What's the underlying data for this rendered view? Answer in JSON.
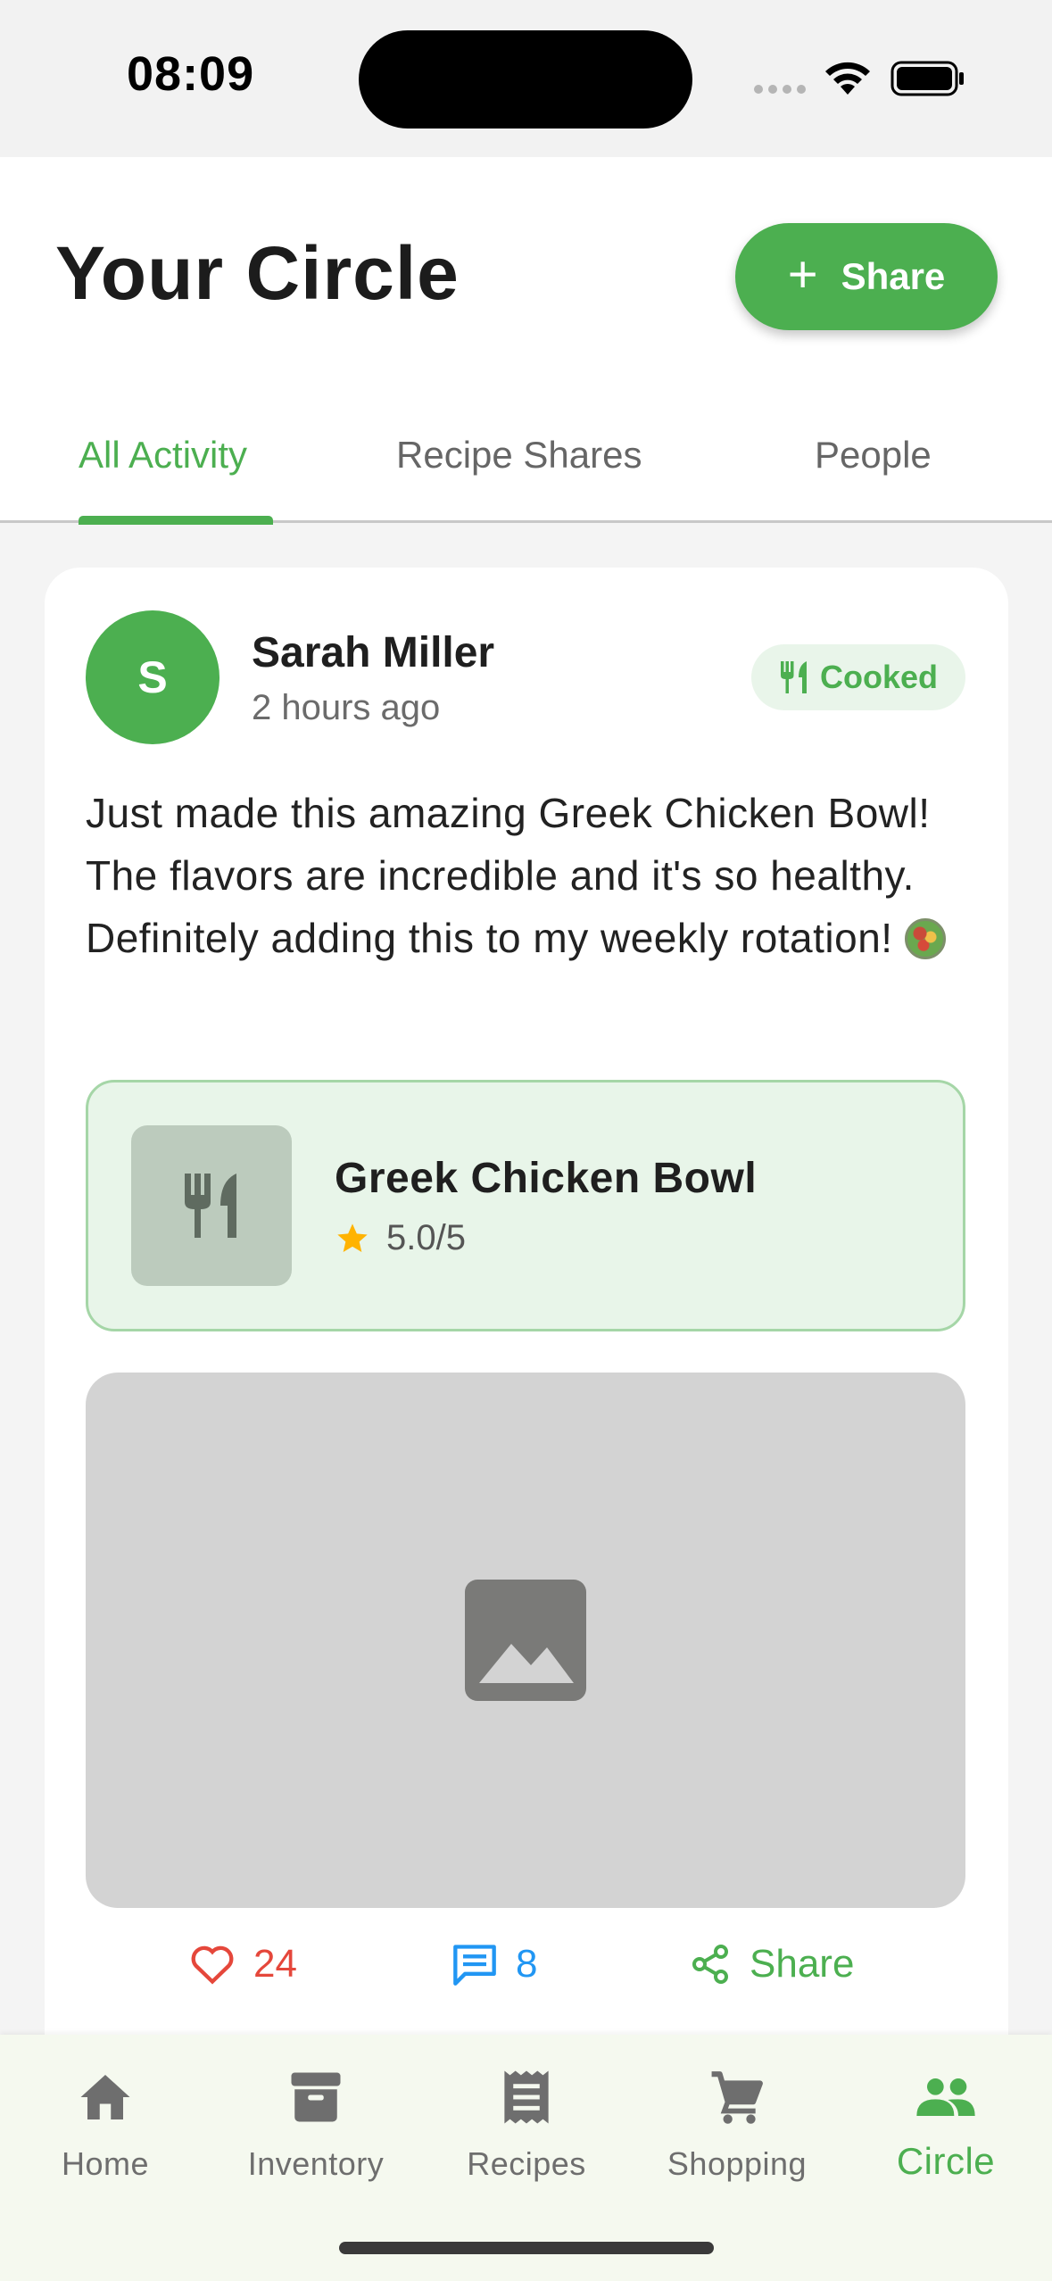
{
  "status_bar": {
    "time": "08:09"
  },
  "header": {
    "title": "Your Circle",
    "share_button_label": "Share"
  },
  "tabs": [
    {
      "label": "All Activity",
      "active": true
    },
    {
      "label": "Recipe Shares",
      "active": false
    },
    {
      "label": "People",
      "active": false
    }
  ],
  "post": {
    "author_initial": "S",
    "author_name": "Sarah Miller",
    "time_ago": "2 hours ago",
    "badge_label": "Cooked",
    "text": "Just made this amazing Greek Chicken Bowl! The flavors are incredible and it's so healthy. Definitely adding this to my weekly rotation!",
    "emoji_icon": "green-salad-emoji",
    "recipe": {
      "title": "Greek Chicken Bowl",
      "rating": "5.0/5"
    },
    "likes": "24",
    "comments": "8",
    "share_label": "Share"
  },
  "bottom_nav": {
    "items": [
      {
        "label": "Home",
        "icon": "home-icon"
      },
      {
        "label": "Inventory",
        "icon": "inventory-icon"
      },
      {
        "label": "Recipes",
        "icon": "recipes-icon"
      },
      {
        "label": "Shopping",
        "icon": "cart-icon"
      },
      {
        "label": "Circle",
        "icon": "people-icon",
        "active": true
      }
    ]
  },
  "colors": {
    "accent": "#4caf50",
    "like": "#e5473b",
    "comment": "#2196f3",
    "star": "#ffb300"
  }
}
